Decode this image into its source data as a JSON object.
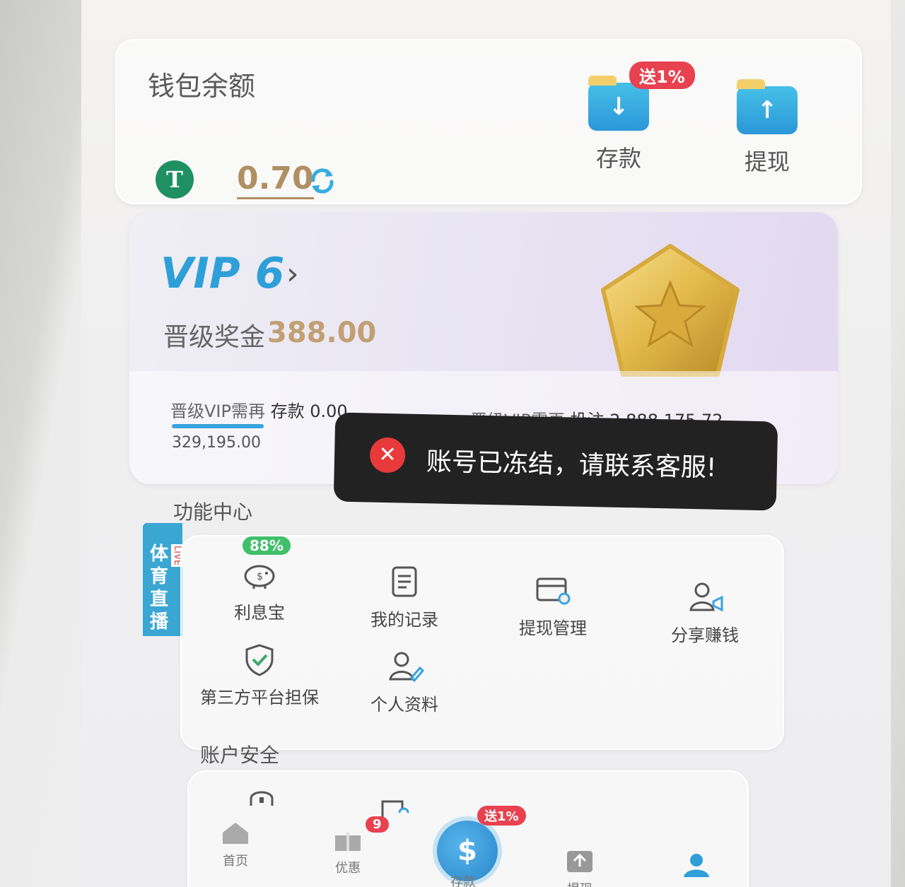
{
  "wallet": {
    "title": "钱包余额",
    "currency_icon": "tether-icon",
    "balance": "0.70",
    "deposit_label": "存款",
    "withdraw_label": "提现",
    "deposit_badge": "送1%"
  },
  "vip": {
    "level": "VIP 6",
    "bonus_label": "晋级奖金",
    "bonus_value": "388.00",
    "deposit_req_prefix": "晋级VIP需再",
    "deposit_req_kind": "存款",
    "deposit_req_value": "0.00",
    "deposit_need": "329,195.00",
    "bet_req_prefix": "晋级VIP需再",
    "bet_req_kind": "投注",
    "bet_req_value": "2,888,175.72"
  },
  "toast": {
    "message": "账号已冻结，请联系客服!"
  },
  "features": {
    "title": "功能中心",
    "items": [
      {
        "label": "利息宝",
        "badge": "88%"
      },
      {
        "label": "我的记录"
      },
      {
        "label": "提现管理"
      },
      {
        "label": "分享赚钱"
      },
      {
        "label": "第三方平台担保"
      },
      {
        "label": "个人资料"
      }
    ]
  },
  "sports_tab": {
    "label": "体育直播",
    "live": "LIVE"
  },
  "security": {
    "title": "账户安全"
  },
  "nav": {
    "items": [
      {
        "label": "首页"
      },
      {
        "label": "优惠",
        "badge": "9"
      },
      {
        "label": "存款",
        "badge": "送1%"
      },
      {
        "label": "提现"
      },
      {
        "label": ""
      }
    ]
  },
  "colors": {
    "accent_blue": "#2f9fd8",
    "gold": "#c2a074",
    "badge_red": "#e8414f",
    "badge_green": "#3fc06a",
    "toast_bg": "#232222"
  }
}
